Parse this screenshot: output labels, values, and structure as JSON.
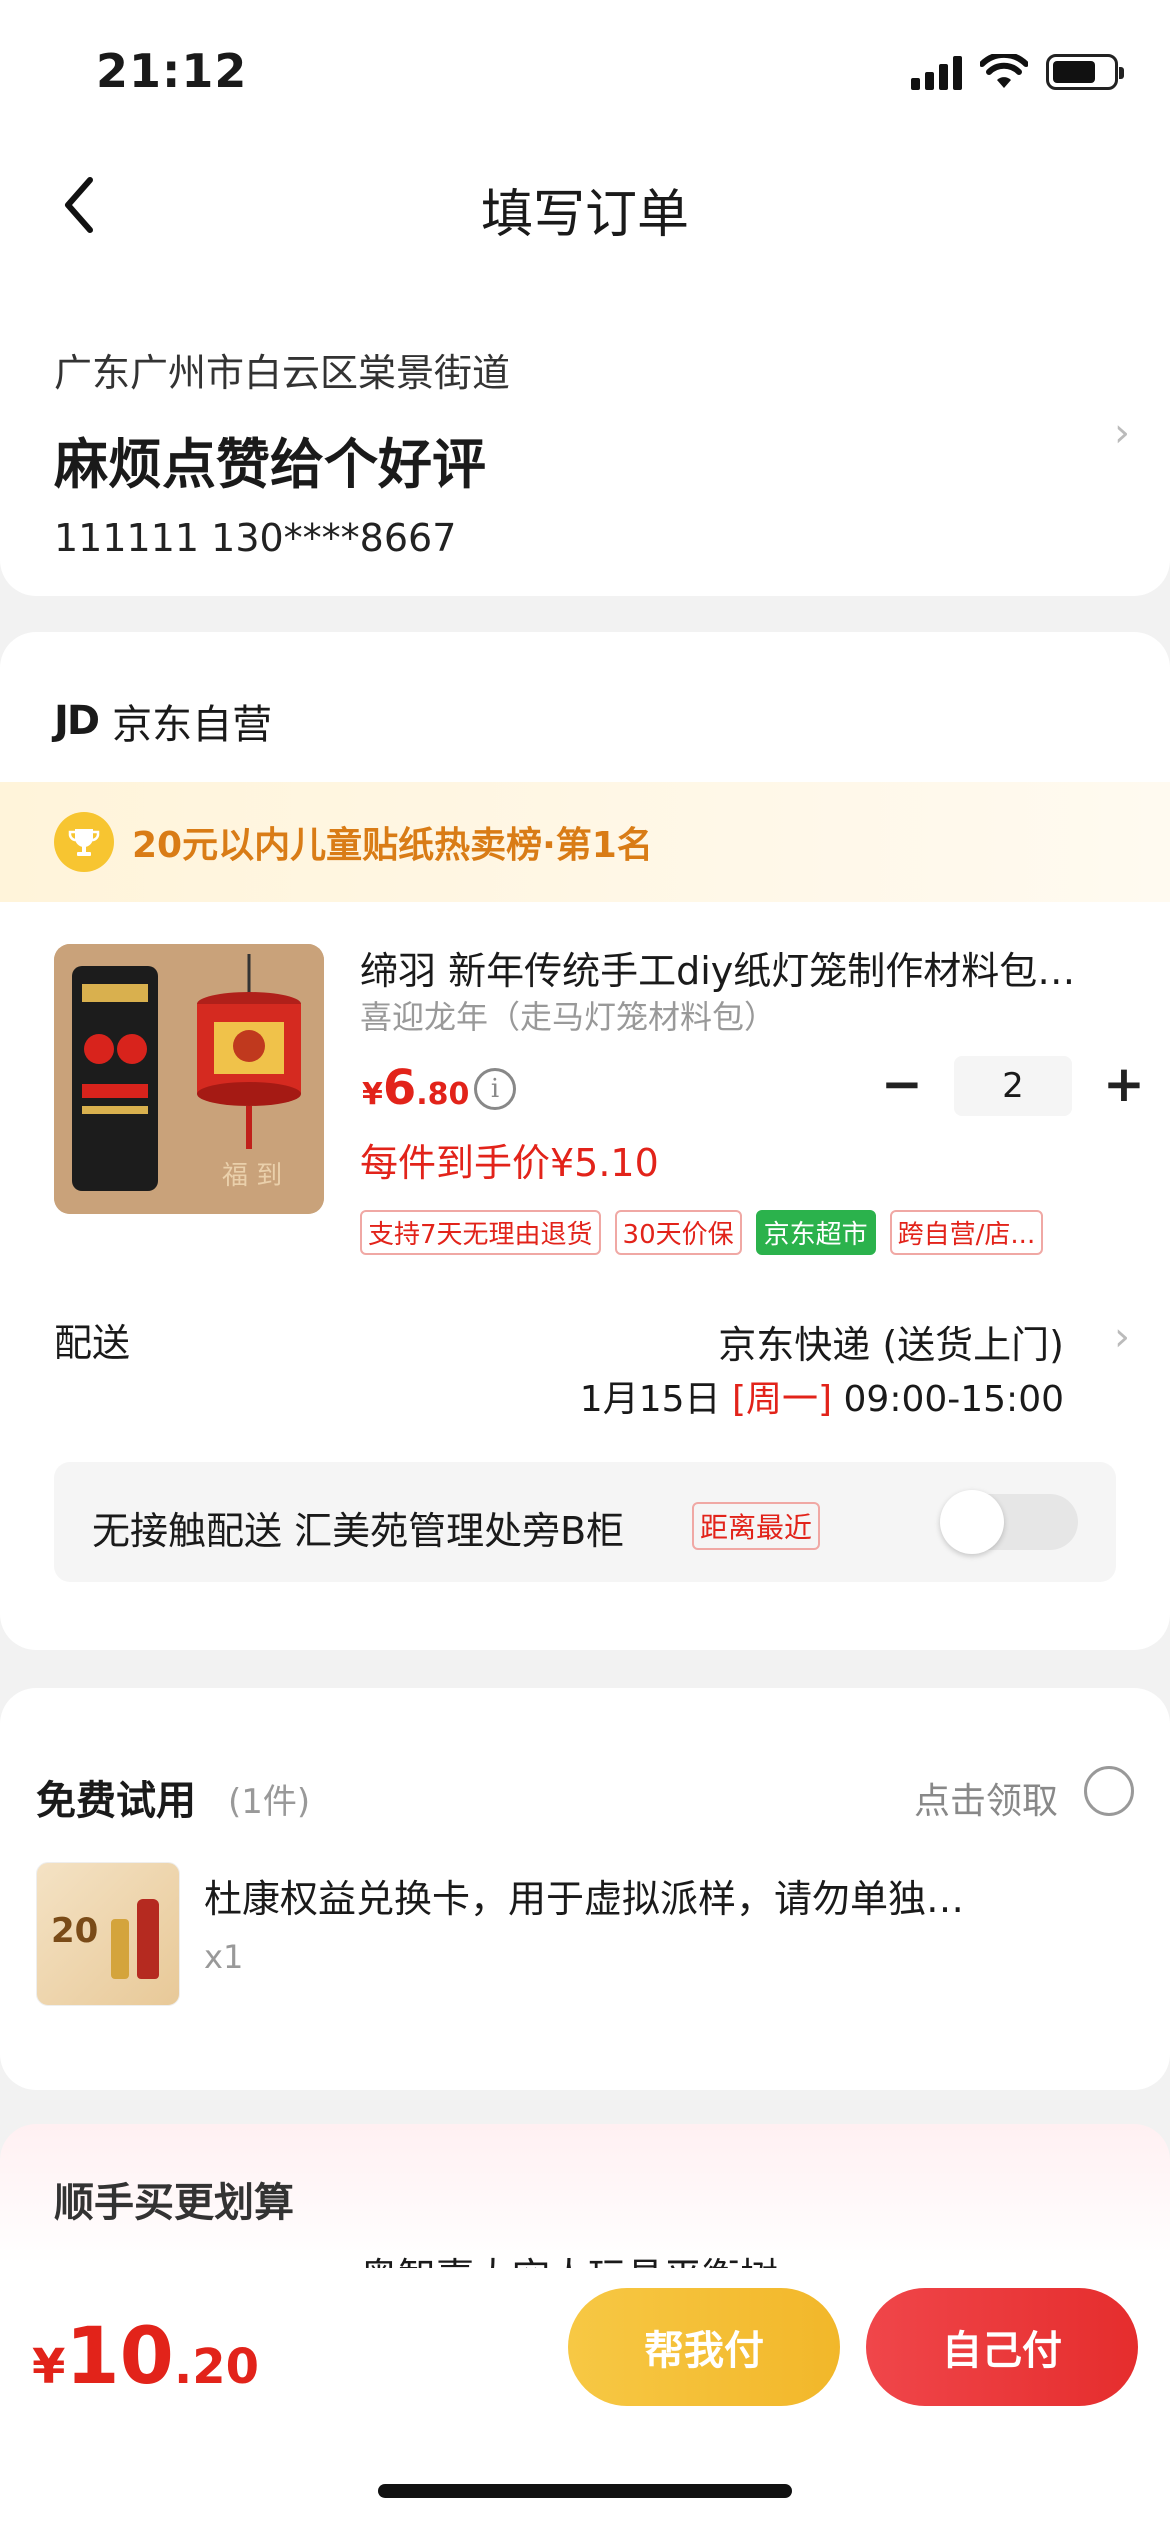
{
  "status_bar": {
    "time": "21:12"
  },
  "nav": {
    "title": "填写订单"
  },
  "address": {
    "region": "广东广州市白云区棠景街道",
    "detail": "麻烦点赞给个好评",
    "contact": "111111  130****8667"
  },
  "shop": {
    "name": "京东自营",
    "rank_banner": "20元以内儿童贴纸热卖榜·第1名",
    "product": {
      "title": "缔羽 新年传统手工diy纸灯笼制作材料包…",
      "sku": "喜迎龙年（走马灯笼材料包）",
      "price_yen": "¥",
      "price_int": "6",
      "price_dec": ".80",
      "quantity": "2",
      "unit_price_label": "每件到手价¥5.10",
      "tags": [
        "支持7天无理由退货",
        "30天价保",
        "京东超市",
        "跨自营/店..."
      ]
    },
    "delivery": {
      "label": "配送",
      "method": "京东快递 (送货上门)",
      "date": "1月15日",
      "weekday": "[周一]",
      "time": "09:00-15:00"
    },
    "contactless": {
      "text": "无接触配送  汇美苑管理处旁B柜",
      "badge": "距离最近",
      "enabled": false
    }
  },
  "trial": {
    "title": "免费试用",
    "count": "(1件)",
    "claim": "点击领取",
    "item_name": "杜康权益兑换卡，用于虚拟派样，请勿单独…",
    "item_qty": "x1",
    "thumb_text": "20"
  },
  "upsell": {
    "title": "顺手买更划算",
    "item_name": "奥智嘉太空人玩具平衡树"
  },
  "footer": {
    "total_yen": "¥",
    "total_int": "10",
    "total_dec": ".20",
    "help_pay": "帮我付",
    "self_pay": "自己付"
  },
  "colors": {
    "accent_red": "#e2231a",
    "gold": "#f2b72a",
    "green_tag": "#2bb24c"
  }
}
